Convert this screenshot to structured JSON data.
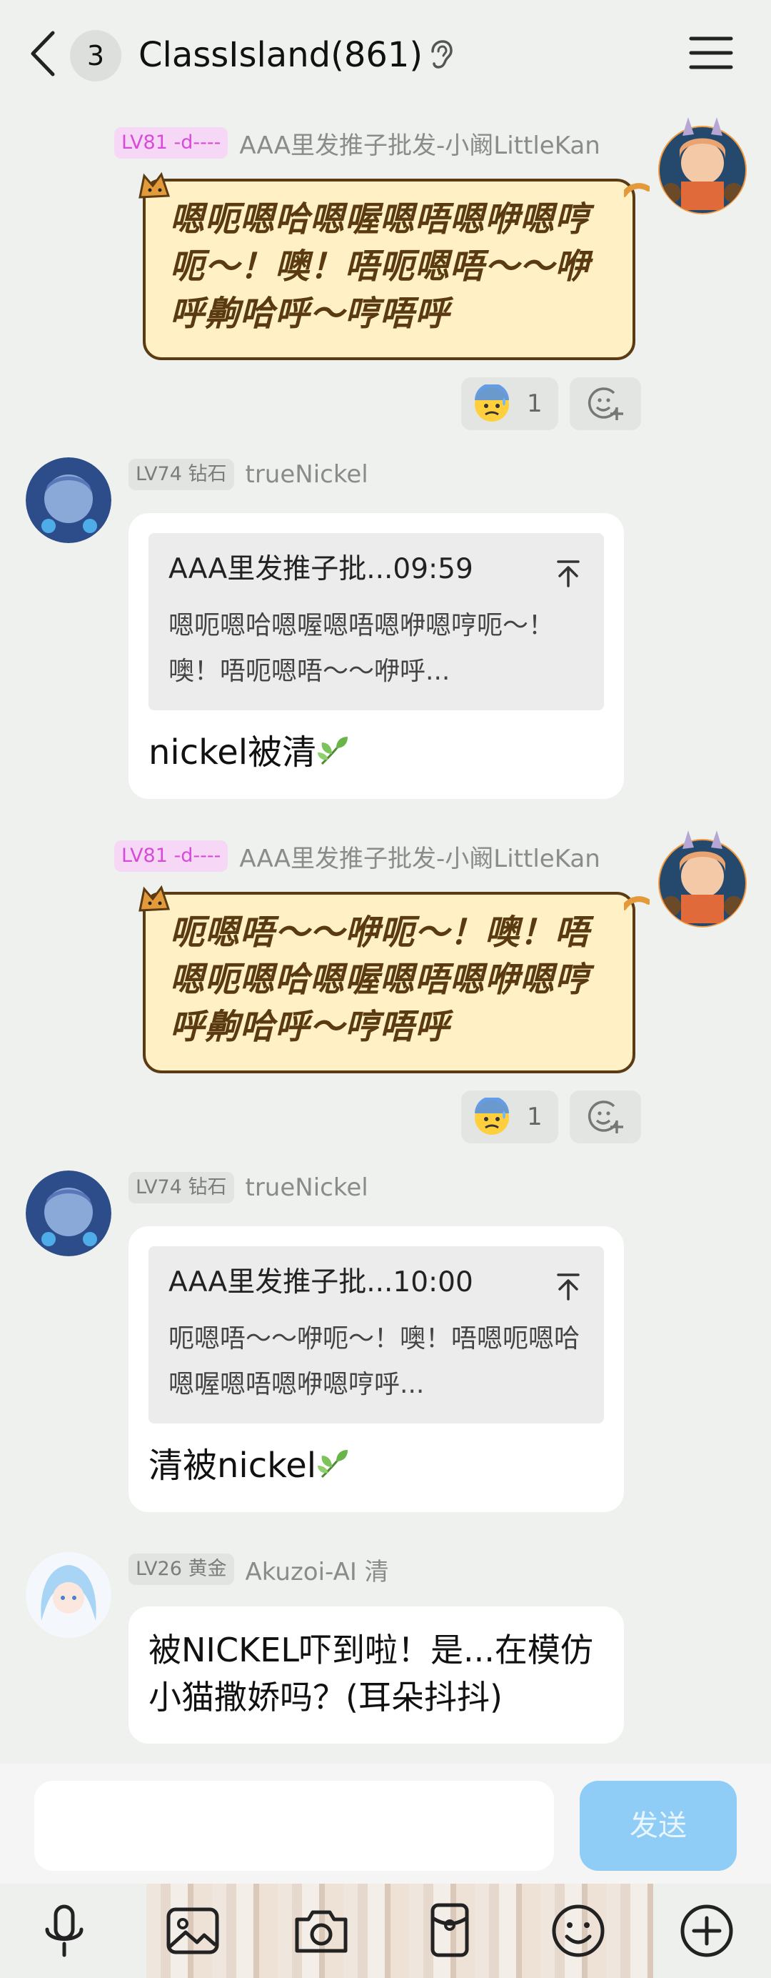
{
  "header": {
    "unread_count": "3",
    "title": "ClassIsland(861)"
  },
  "messages": [
    {
      "level": "LV81 -d----",
      "name": "AAA里发推子批发-小阚LittleKan",
      "text": "嗯呃嗯哈嗯喔嗯唔嗯咿嗯哼呃～！噢！唔呃嗯唔～～咿呼齁哈呼～哼唔呼",
      "reaction_count": "1"
    },
    {
      "level": "LV74 钻石",
      "name": "trueNickel",
      "quote_head": "AAA里发推子批...09:59",
      "quote_body": "嗯呃嗯哈嗯喔嗯唔嗯咿嗯哼呃～！噢！唔呃嗯唔～～咿呼...",
      "text": "nickel被清"
    },
    {
      "level": "LV81 -d----",
      "name": "AAA里发推子批发-小阚LittleKan",
      "text": "呃嗯唔～～咿呃～！噢！唔嗯呃嗯哈嗯喔嗯唔嗯咿嗯哼呼齁哈呼～哼唔呼",
      "reaction_count": "1"
    },
    {
      "level": "LV74 钻石",
      "name": "trueNickel",
      "quote_head": "AAA里发推子批...10:00",
      "quote_body": "呃嗯唔～～咿呃～！噢！唔嗯呃嗯哈嗯喔嗯唔嗯咿嗯哼呼...",
      "text": "清被nickel"
    },
    {
      "level": "LV26 黄金",
      "name": "Akuzoi-AI 清",
      "text": "被NICKEL吓到啦！是...在模仿小猫撒娇吗？(耳朵抖抖)"
    }
  ],
  "input": {
    "send_label": "发送"
  },
  "icons": {
    "back": "chevron-left-icon",
    "ear": "ear-icon",
    "menu": "menu-icon",
    "toolbar": [
      "microphone-icon",
      "image-icon",
      "camera-icon",
      "red-packet-icon",
      "emoji-icon",
      "plus-icon"
    ]
  },
  "colors": {
    "background": "#eef1ee",
    "send_button": "#8fcdf6",
    "fancy_bubble": "#fff1c5",
    "level_pink": "#d64cd8"
  }
}
